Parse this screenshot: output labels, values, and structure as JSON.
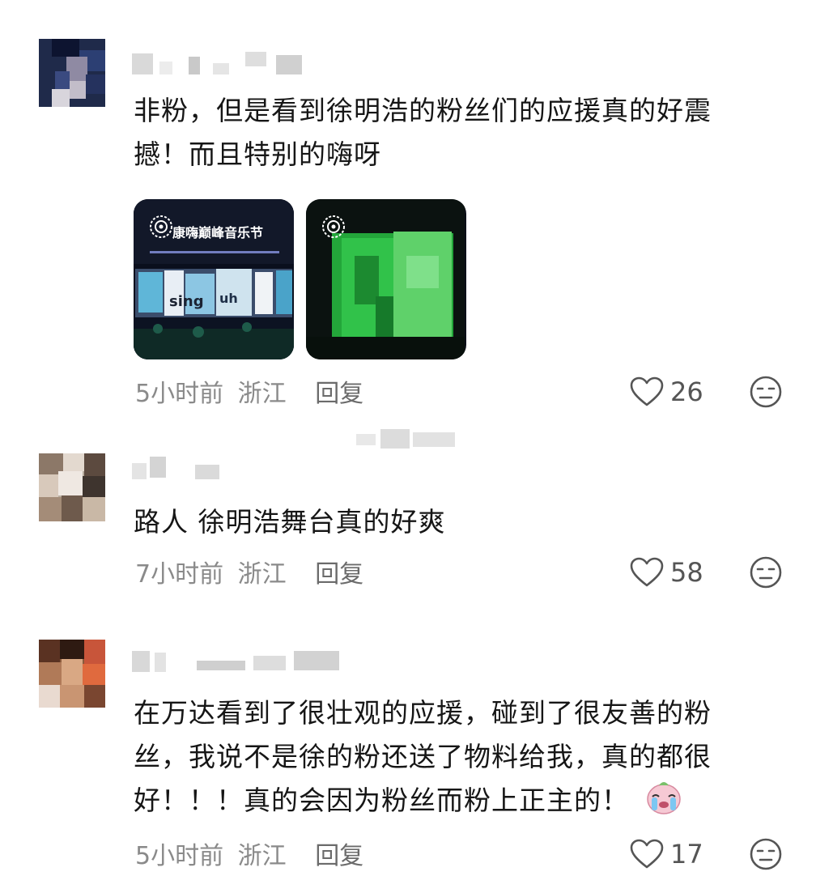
{
  "comments": [
    {
      "text": "非粉，但是看到徐明浩的粉丝们的应援真的好震撼！而且特别的嗨呀",
      "time": "5小时前",
      "location": "浙江",
      "reply_label": "回复",
      "likes": "26",
      "images": [
        {
          "caption": "康嗨巅峰音乐节"
        },
        {
          "caption": ""
        }
      ]
    },
    {
      "text": "路人 徐明浩舞台真的好爽",
      "time": "7小时前",
      "location": "浙江",
      "reply_label": "回复",
      "likes": "58"
    },
    {
      "text": "在万达看到了很壮观的应援，碰到了很友善的粉丝，我说不是徐的粉还送了物料给我，真的都很好！！！真的会因为粉丝而粉上正主的！",
      "time": "5小时前",
      "location": "浙江",
      "reply_label": "回复",
      "likes": "17"
    }
  ],
  "icons": {
    "like": "heart-outline-icon",
    "dislike": "unamused-face-icon",
    "emoji": "crying-face-emoji"
  },
  "colors": {
    "text": "#161616",
    "meta": "#8a8a8a",
    "icon": "#555555",
    "emoji": "#f2b8c6"
  }
}
